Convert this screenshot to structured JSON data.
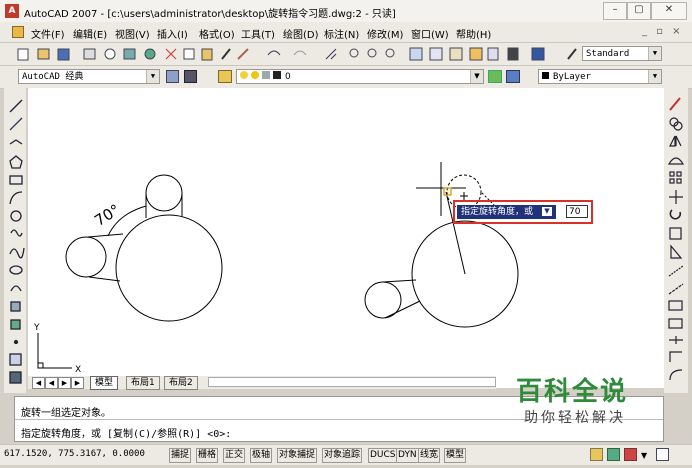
{
  "window": {
    "title": "AutoCAD 2007 - [c:\\users\\administrator\\desktop\\旋转指令习题.dwg:2 - 只读]",
    "min_label": "–",
    "max_label": "▢",
    "close_label": "✕"
  },
  "menu": [
    "文件(F)",
    "编辑(E)",
    "视图(V)",
    "插入(I)",
    "格式(O)",
    "工具(T)",
    "绘图(D)",
    "标注(N)",
    "修改(M)",
    "窗口(W)",
    "帮助(H)"
  ],
  "menu_window_controls": "_ ▫ ×",
  "toolbar": {
    "text_style": "Standard",
    "workspace": "AutoCAD 经典",
    "layer_value": "0",
    "color": "ByLayer"
  },
  "canvas": {
    "angle_label": "70°",
    "dyn_prompt": "指定旋转角度，或",
    "dyn_value": "70",
    "ucs_x": "X",
    "ucs_y": "Y"
  },
  "tabs": [
    "模型",
    "布局1",
    "布局2"
  ],
  "command": {
    "line1": "旋转一组选定对象。",
    "line2": "指定旋转角度，或 [复制(C)/参照(R)] <0>:"
  },
  "status": {
    "coords": "617.1520,  775.3167,  0.0000",
    "buttons": [
      "捕捉",
      "栅格",
      "正交",
      "极轴",
      "对象捕捉",
      "对象追踪",
      "DUCS",
      "DYN",
      "线宽",
      "模型"
    ]
  },
  "watermark": {
    "main": "百科全说",
    "sub": "助你轻松解决"
  },
  "colors": {
    "accent_red": "#d9302a",
    "dyn_bg": "#20337a",
    "watermark_green": "#2e8b3a"
  }
}
